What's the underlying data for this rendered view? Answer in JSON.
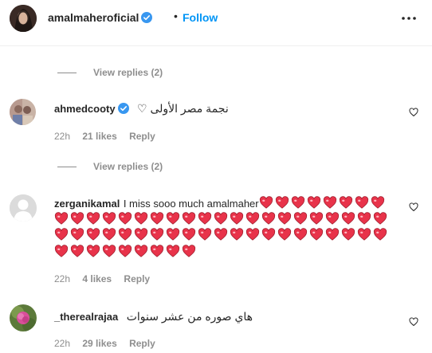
{
  "header": {
    "username": "amalmaheroficial",
    "follow_label": "Follow",
    "separator": "•"
  },
  "thread1": {
    "view_replies": "View replies (2)"
  },
  "comment1": {
    "username": "ahmedcooty",
    "text": "نجمة مصر الأولى ♡",
    "time": "22h",
    "likes": "21 likes",
    "reply": "Reply"
  },
  "thread2": {
    "view_replies": "View replies (2)"
  },
  "comment2": {
    "username": "zerganikamal",
    "text": "I miss sooo much amalmaher",
    "heart_count": 59,
    "time": "22h",
    "likes": "4 likes",
    "reply": "Reply"
  },
  "comment3": {
    "username": "_therealrajaa",
    "text": "هاي صوره من عشر سنوات",
    "time": "22h",
    "likes": "29 likes",
    "reply": "Reply"
  },
  "colors": {
    "link": "#0095f6",
    "muted": "#8e8e8e",
    "text": "#262626",
    "verified": "#3897f0",
    "heart_emoji": "#e8334a"
  }
}
